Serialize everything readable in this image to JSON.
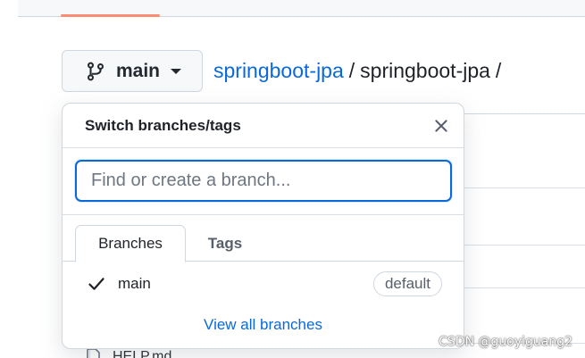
{
  "branch_button": {
    "label": "main"
  },
  "breadcrumb": {
    "repo_link": "springboot-jpa",
    "separator": "/",
    "folder": "springboot-jpa",
    "trailing_separator": "/"
  },
  "dropdown": {
    "title": "Switch branches/tags",
    "filter_placeholder": "Find or create a branch...",
    "tabs": [
      {
        "label": "Branches",
        "active": true
      },
      {
        "label": "Tags",
        "active": false
      }
    ],
    "branches": [
      {
        "name": "main",
        "selected": true,
        "badge": "default"
      }
    ],
    "view_all_label": "View all branches"
  },
  "background": {
    "partial_file_label": "HELP.md"
  },
  "watermark": "CSDN @guoyiguang2",
  "colors": {
    "link": "#0969da",
    "accent_underline": "#fd8c73",
    "border": "#d0d7de"
  }
}
